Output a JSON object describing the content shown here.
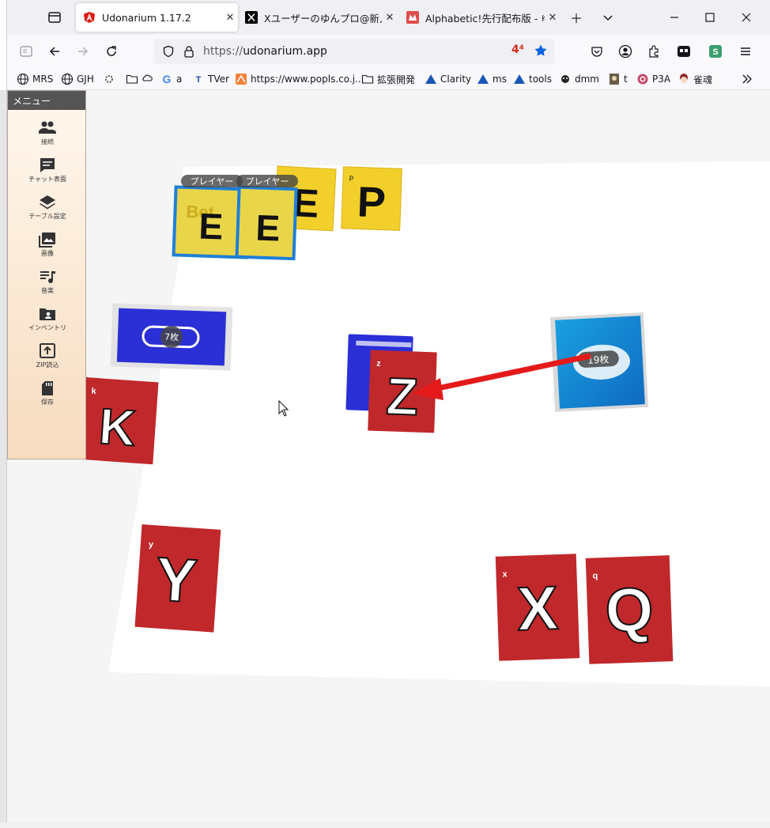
{
  "tabs": [
    {
      "title": "Udonarium 1.17.2",
      "active": true
    },
    {
      "title": "Xユーザーのゆんプロ@新人同人",
      "active": false
    },
    {
      "title": "Alphabetic!先行配布版 - ゆん",
      "active": false
    }
  ],
  "url": {
    "prefix": "https://",
    "host": "udonarium.app",
    "badge": "4⁴"
  },
  "bookmarks": [
    "MRS",
    "GJH",
    "a",
    "TVer",
    "https://www.popls.co.j...",
    "拡張開発",
    "Clarity",
    "ms",
    "tools",
    "dmm",
    "t",
    "P3A",
    "雀魂"
  ],
  "menu": {
    "title": "メニュー",
    "items": [
      {
        "label": "接続",
        "icon": "people-icon"
      },
      {
        "label": "チャット表面",
        "icon": "chat-icon"
      },
      {
        "label": "テーブル設定",
        "icon": "layers-icon"
      },
      {
        "label": "画像",
        "icon": "image-icon"
      },
      {
        "label": "音楽",
        "icon": "music-icon"
      },
      {
        "label": "インベントリ",
        "icon": "folder-user-icon"
      },
      {
        "label": "ZIP読込",
        "icon": "upload-icon"
      },
      {
        "label": "保存",
        "icon": "sd-card-icon"
      }
    ]
  },
  "table": {
    "players": [
      "プレイヤー",
      "プレイヤー"
    ],
    "deck_blue_count": "7枚",
    "deck_main_count": "19枚",
    "cards": {
      "yellow": [
        "E",
        "E",
        "E",
        "P"
      ],
      "red": [
        "K",
        "Z",
        "Y",
        "X",
        "Q"
      ]
    },
    "colors": {
      "red": "#c0282b",
      "yellow": "#f2cf2a",
      "blue": "#2b2fd6",
      "arrow": "#e41a1a"
    }
  }
}
